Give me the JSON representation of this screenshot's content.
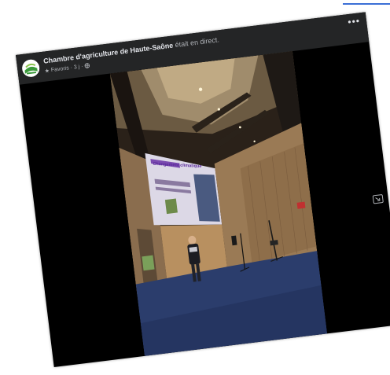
{
  "post": {
    "page_name": "Chambre d'agriculture de Haute-Saône",
    "action": "était en direct.",
    "favorites_label": "Favoris",
    "time": "3 j",
    "separator": "·"
  },
  "icons": {
    "avatar": "chambre-agriculture-logo",
    "favorite": "star-icon",
    "audience": "globe-icon",
    "more": "more-options-icon",
    "expand": "expand-icon"
  },
  "screen_text": {
    "title": "Changement climatique"
  },
  "colors": {
    "header_bg": "#242526",
    "page_bg": "#000000",
    "text_primary": "#e4e6eb",
    "text_secondary": "#b0b3b8",
    "carpet": "#2b3d6c"
  }
}
